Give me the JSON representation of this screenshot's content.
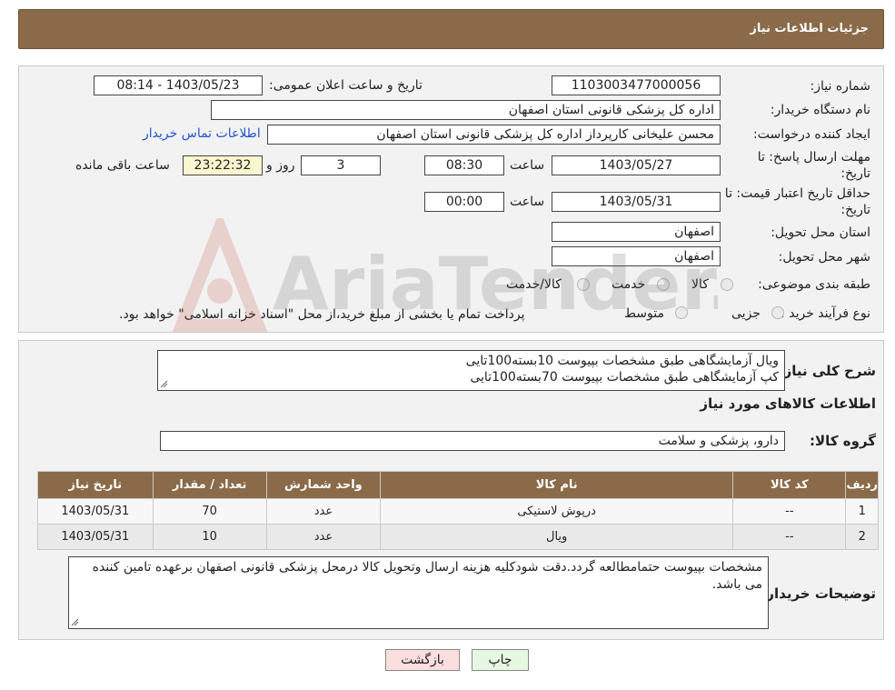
{
  "header": {
    "title": "جزئیات اطلاعات نیاز"
  },
  "form": {
    "need_number_label": "شماره نیاز:",
    "need_number": "1103003477000056",
    "announce_label": "تاریخ و ساعت اعلان عمومی:",
    "announce_value": "1403/05/23 - 08:14",
    "buyer_org_label": "نام دستگاه خریدار:",
    "buyer_org": "اداره کل پزشکی قانونی استان اصفهان",
    "creator_label": "ایجاد کننده درخواست:",
    "creator": "محسن علیخانی کارپرداز اداره کل پزشکی قانونی استان اصفهان",
    "contact_link": "اطلاعات تماس خریدار",
    "deadline_label_1": "مهلت ارسال پاسخ: تا",
    "deadline_label_2": "تاریخ:",
    "deadline_date": "1403/05/27",
    "time_label": "ساعت",
    "deadline_time": "08:30",
    "days_value": "3",
    "days_label": "روز و",
    "remaining_time": "23:22:32",
    "remaining_label": "ساعت باقی مانده",
    "validity_label_1": "حداقل تاریخ اعتبار قیمت: تا",
    "validity_label_2": "تاریخ:",
    "validity_date": "1403/05/31",
    "validity_time_label": "ساعت",
    "validity_time": "00:00",
    "province_label": "استان محل تحویل:",
    "province": "اصفهان",
    "city_label": "شهر محل تحویل:",
    "city": "اصفهان",
    "category_label": "طبقه بندی موضوعی:",
    "category_options": [
      "کالا",
      "خدمت",
      "کالا/خدمت"
    ],
    "process_label": "نوع فرآیند خرید :",
    "process_options": [
      "جزیی",
      "متوسط"
    ],
    "process_note": "پرداخت تمام یا بخشی از مبلغ خرید،از محل \"اسناد خزانه اسلامی\" خواهد بود."
  },
  "watermark": {
    "text": "AriaTender.neT"
  },
  "details": {
    "summary_label": "شرح کلی نیاز:",
    "summary_line1": "ویال آزمایشگاهی طبق مشخصات بپیوست 10بسته100تایی",
    "summary_line2": "کپ آزمایشگاهی طبق مشخصات بپیوست 70بسته100تایی",
    "goods_info_title": "اطلاعات کالاهای مورد نیاز",
    "goods_group_label": "گروه کالا:",
    "goods_group": "دارو، پزشکی و سلامت",
    "table_headers": [
      "ردیف",
      "کد کالا",
      "نام کالا",
      "واحد شمارش",
      "تعداد / مقدار",
      "تاریخ نیاز"
    ],
    "rows": [
      [
        "1",
        "--",
        "درپوش لاستیکی",
        "عدد",
        "70",
        "1403/05/31"
      ],
      [
        "2",
        "--",
        "ویال",
        "عدد",
        "10",
        "1403/05/31"
      ]
    ],
    "buyer_notes_label": "توضیحات خریدار:",
    "buyer_notes": "مشخصات بپیوست حتمامطالعه گردد.دقت شودکلیه هزینه ارسال وتحویل کالا درمحل پزشکی قانونی اصفهان برعهده تامین کننده می باشد."
  },
  "buttons": {
    "back": "بازگشت",
    "print": "چاپ"
  },
  "colors": {
    "header_brown": "#8a6a48",
    "link_blue": "#2255cc",
    "remaining_bg": "#fbf6cf",
    "back_btn": "#fbdede",
    "print_btn": "#e6f8e1"
  }
}
